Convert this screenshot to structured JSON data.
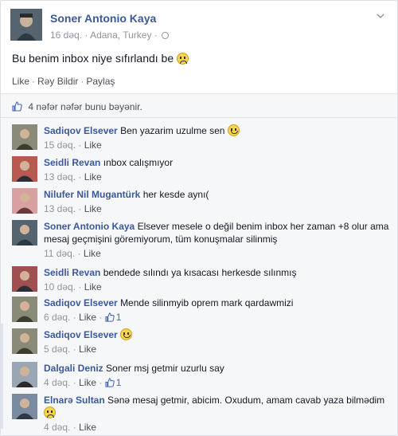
{
  "post": {
    "author": "Soner Antonio Kaya",
    "time": "16 dəq.",
    "location": "Adana, Turkey",
    "text": "Bu benim inbox niye sıfırlandı be",
    "actions": {
      "like": "Like",
      "comment": "Rəy Bildir",
      "share": "Paylaş"
    },
    "likes_text": "4 nəfər nəfər bunu bəyənir."
  },
  "comments": [
    {
      "name": "Sadiqov Elsever",
      "text": "Ben yazarim uzulme sen",
      "emoji": "happy",
      "time": "15 dəq.",
      "like": "Like",
      "likes": ""
    },
    {
      "name": "Seidli Revan",
      "text": "ınbox calışmıyor",
      "time": "13 dəq.",
      "like": "Like",
      "likes": ""
    },
    {
      "name": "Nilufer Nil Mugantürk",
      "text": "her kesde aynı(",
      "time": "13 dəq.",
      "like": "Like",
      "likes": ""
    },
    {
      "name": "Soner Antonio Kaya",
      "text": "Elsever mesele o değil benim inbox her zaman +8 olur ama mesaj geçmişini göremiyorum, tüm konuşmalar silinmiş",
      "time": "11 dəq.",
      "like": "Like",
      "likes": ""
    },
    {
      "name": "Seidli Revan",
      "text": "bendede sılındı ya kısacası herkesde sılınmış",
      "time": "10 dəq.",
      "like": "Like",
      "likes": ""
    },
    {
      "name": "Sadiqov Elsever",
      "text": "Mende silinmyib oprem mark qardawmizi",
      "time": "6 dəq.",
      "like": "Like",
      "likes": "1"
    },
    {
      "name": "Sadiqov Elsever",
      "text": "",
      "emoji": "happy",
      "time": "5 dəq.",
      "like": "Like",
      "likes": ""
    },
    {
      "name": "Dalgali Deniz",
      "text": "Soner msj getmir uzurlu say",
      "time": "4 dəq.",
      "like": "Like",
      "likes": "1"
    },
    {
      "name": "Elnarə Sultan",
      "text": "Sənə mesaj getmir, abicim. Oxudum, amam cavab yaza bilmədim",
      "emoji": "sad",
      "time": "4 dəq.",
      "like": "Like",
      "likes": ""
    }
  ]
}
